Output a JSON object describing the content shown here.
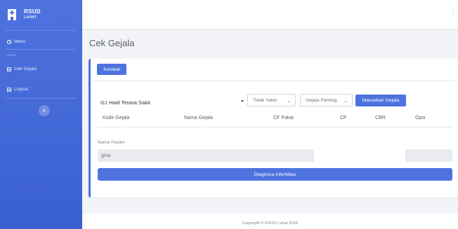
{
  "sidebar": {
    "brand_line1": "RSUD",
    "brand_line2": "LAHAT",
    "menu_label": "Menu",
    "section_heading": "MENU",
    "items": [
      {
        "label": "Cek Gejala",
        "icon": "table-icon"
      },
      {
        "label": "Logout",
        "icon": "logout-icon"
      }
    ],
    "toggle_icon": "chevron-left-icon"
  },
  "page": {
    "title": "Cek Gejala"
  },
  "form": {
    "back_button": "Kembali",
    "symptom_select": "G1 Haid Terasa Sakit",
    "certainty_select": "Tidak Yakin",
    "importance_select": "Gejala Penting",
    "add_button": "Masukkan Gejala"
  },
  "table": {
    "headers": [
      "Kode Gejala",
      "Nama Gejala",
      "CF Pakar",
      "CF",
      "CBR",
      "Opsi"
    ]
  },
  "patient": {
    "label": "Nama Pasien",
    "value": "gina"
  },
  "diagnose_button": "Diagnosa Infertilitas",
  "footer": {
    "copyright": "Copyright © RSUD Lahat 2020"
  },
  "colors": {
    "primary": "#4e73df",
    "background": "#f3f4f7",
    "text": "#5a5c69"
  }
}
